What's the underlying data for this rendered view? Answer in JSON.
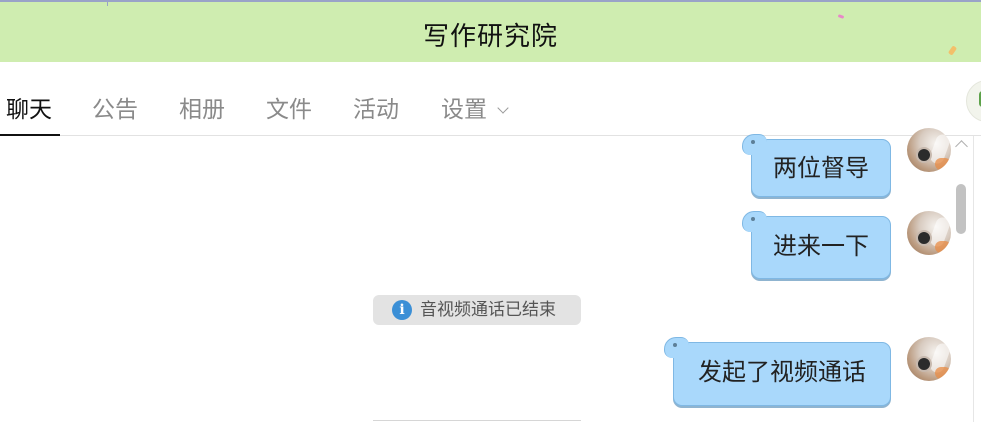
{
  "window": {
    "title": "写作研究院"
  },
  "tabs": [
    {
      "label": "聊天",
      "active": true
    },
    {
      "label": "公告",
      "active": false
    },
    {
      "label": "相册",
      "active": false
    },
    {
      "label": "文件",
      "active": false
    },
    {
      "label": "活动",
      "active": false
    },
    {
      "label": "设置",
      "active": false,
      "has_dropdown": true
    }
  ],
  "messages": [
    {
      "type": "outgoing",
      "text": "两位督导"
    },
    {
      "type": "outgoing",
      "text": "进来一下"
    },
    {
      "type": "system",
      "icon": "info-icon",
      "text": "音视频通话已结束"
    },
    {
      "type": "outgoing",
      "text": "发起了视频通话"
    }
  ],
  "colors": {
    "titlebar": "#cfedb0",
    "bubble": "#a9d8fb",
    "bubble_border": "#7fb8e4",
    "notice_bg": "#e3e3e3",
    "info_icon": "#3b8fd6"
  }
}
